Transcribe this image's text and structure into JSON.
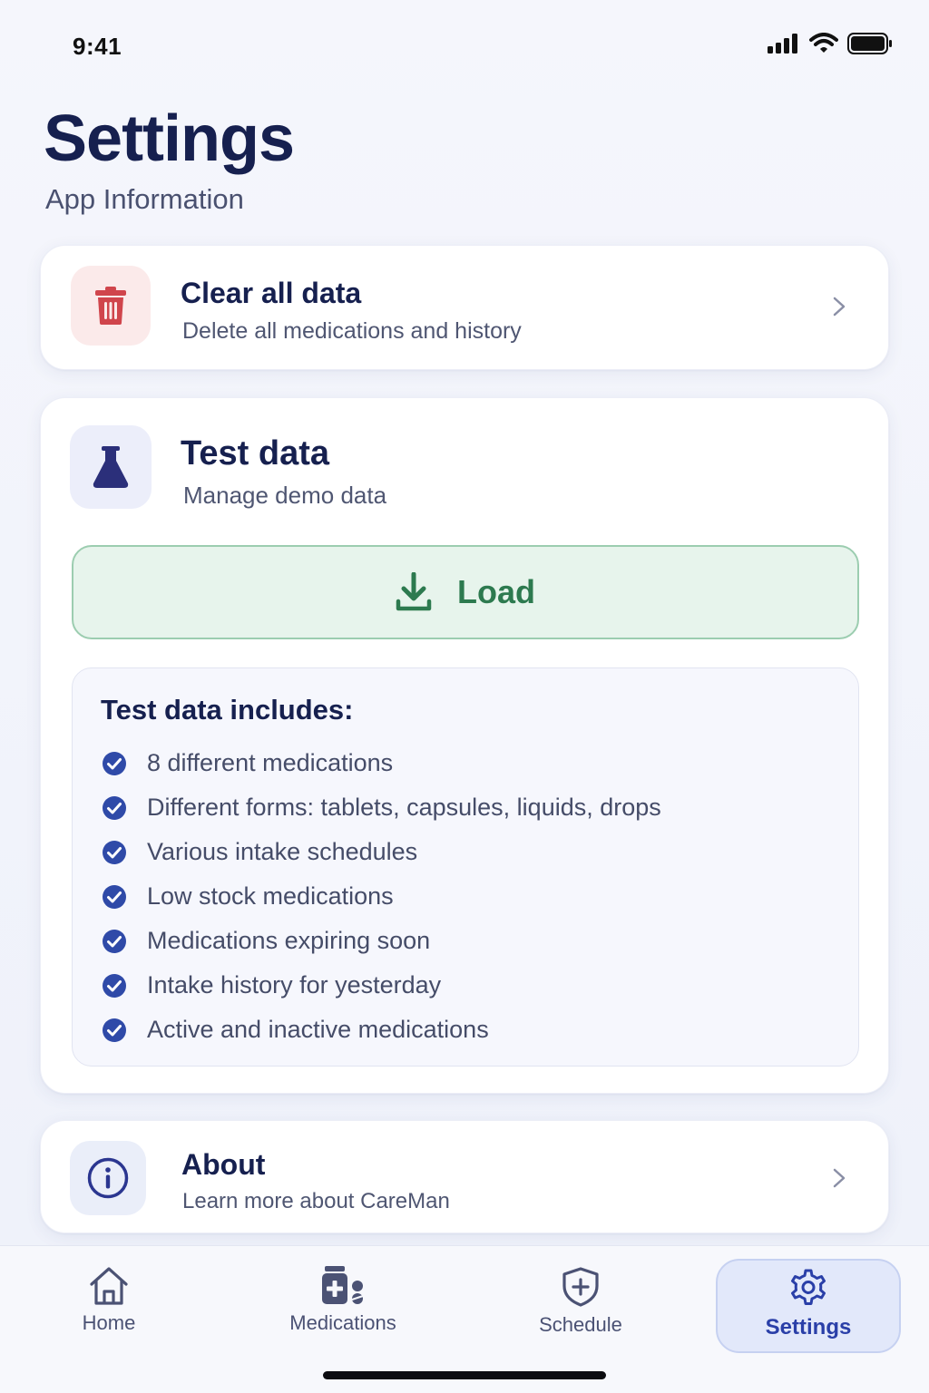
{
  "status_bar": {
    "time": "9:41",
    "icons": [
      "signal-icon",
      "wifi-icon",
      "battery-icon"
    ]
  },
  "header": {
    "title": "Settings",
    "subtitle": "App Information"
  },
  "clear_data": {
    "title": "Clear all data",
    "subtitle": "Delete all medications and history",
    "icon": "trash-icon",
    "accent": "#d0454c"
  },
  "test_data": {
    "title": "Test data",
    "subtitle": "Manage demo data",
    "icon": "flask-icon",
    "accent": "#2b2f7a",
    "load_button": {
      "label": "Load",
      "icon": "download-icon",
      "color": "#2d7a4f"
    },
    "includes": {
      "title": "Test data includes:",
      "items": [
        "8 different medications",
        "Different forms: tablets, capsules, liquids, drops",
        "Various intake schedules",
        "Low stock medications",
        "Medications expiring soon",
        "Intake history for yesterday",
        "Active and inactive medications"
      ]
    }
  },
  "about": {
    "title": "About",
    "subtitle": "Learn more about CareMan",
    "icon": "info-icon"
  },
  "nav": {
    "items": [
      {
        "label": "Home",
        "icon": "home-icon"
      },
      {
        "label": "Medications",
        "icon": "medications-icon"
      },
      {
        "label": "Schedule",
        "icon": "shield-plus-icon"
      },
      {
        "label": "Settings",
        "icon": "gear-icon",
        "active": true
      }
    ],
    "active_color": "#2a3fa8"
  }
}
